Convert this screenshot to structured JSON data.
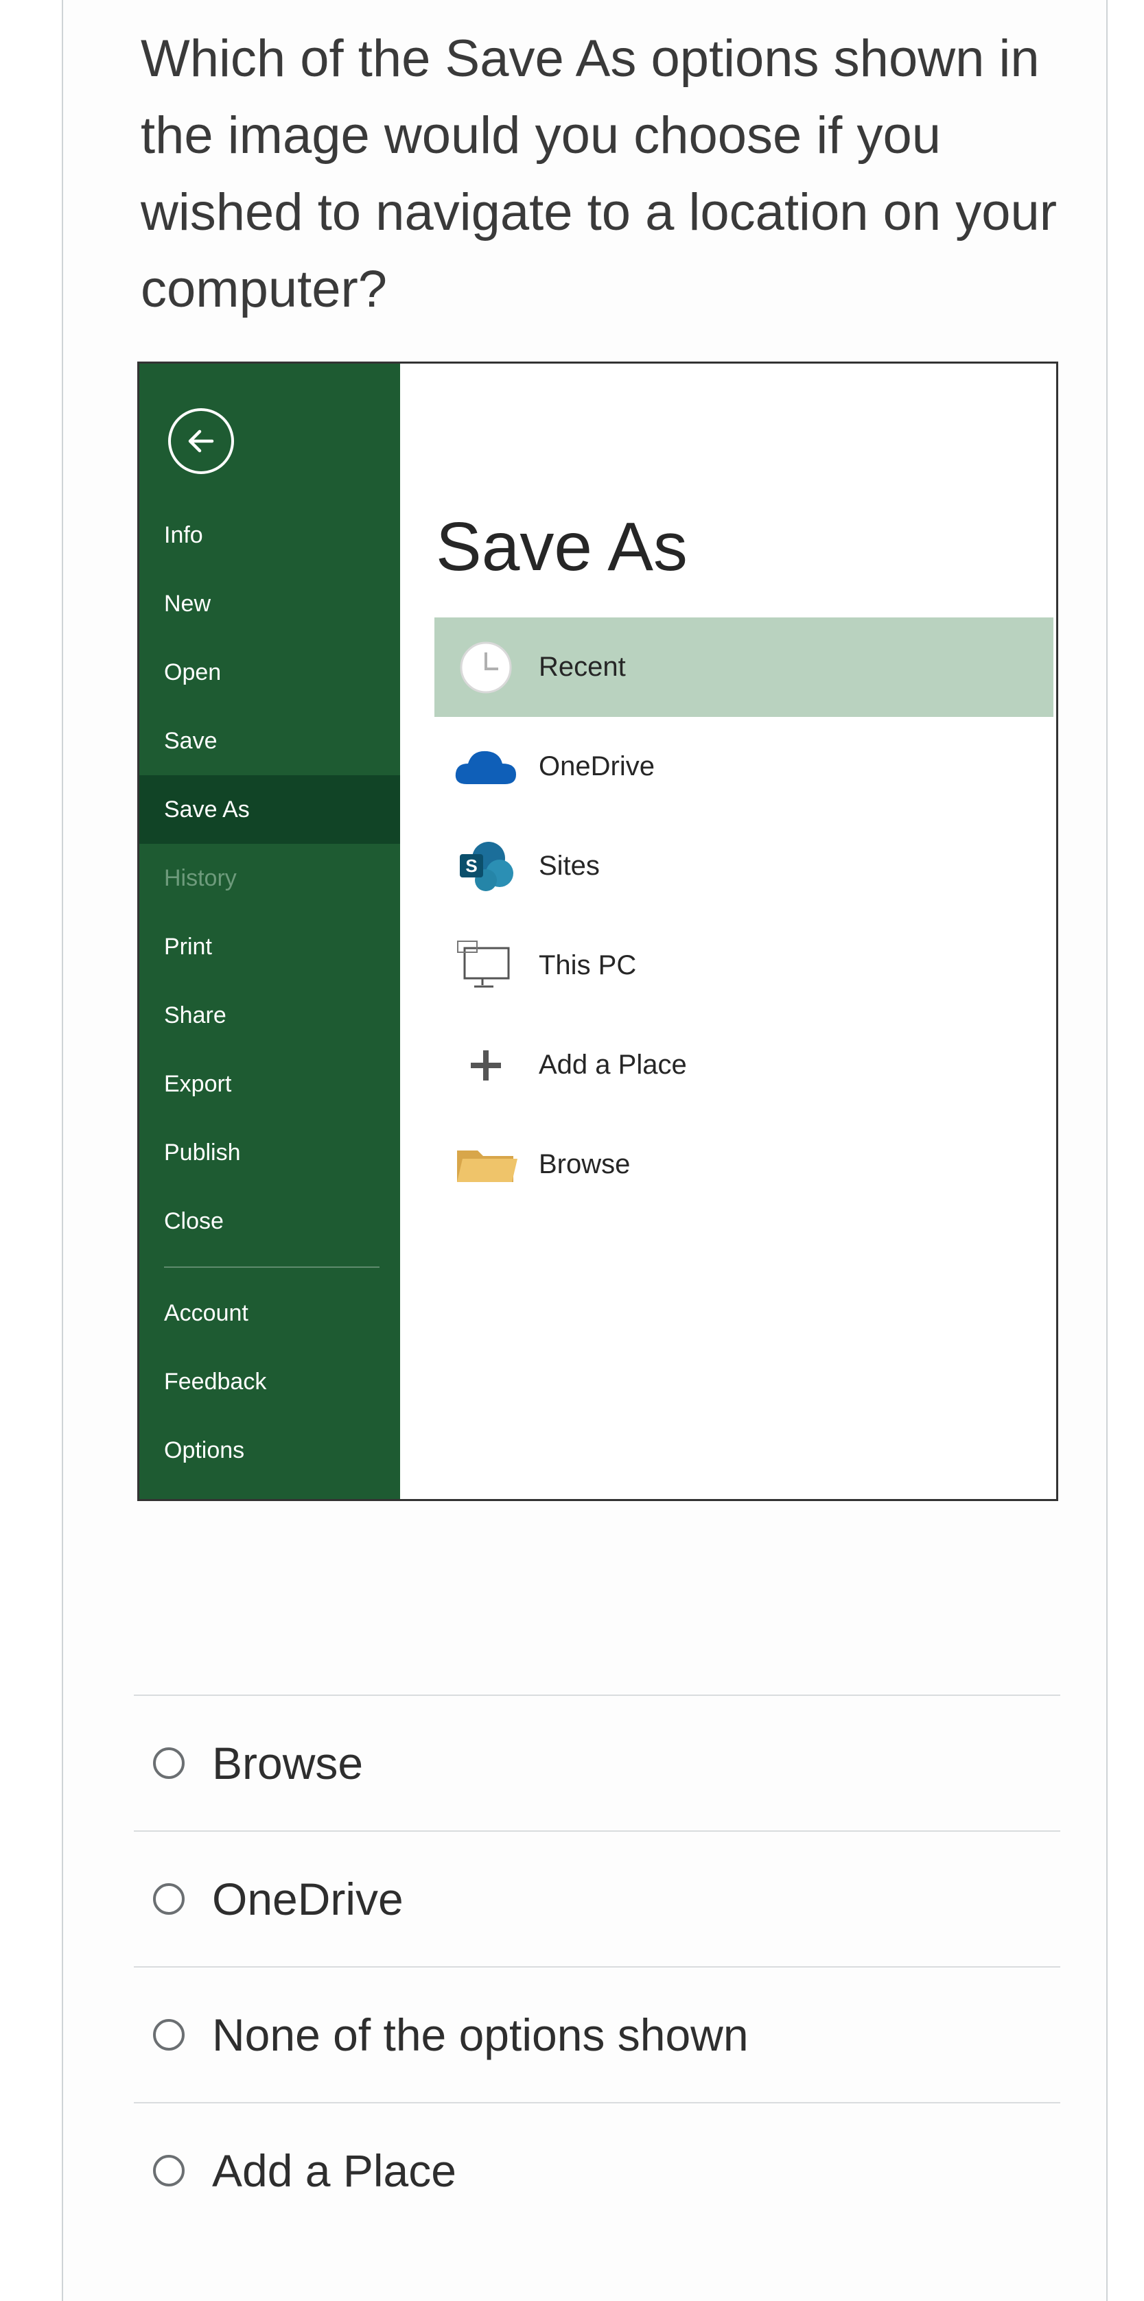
{
  "question": {
    "text": "Which of the Save As options shown in the image would you choose if you wished to navigate to a location on your computer?"
  },
  "backstage": {
    "nav_items": [
      {
        "label": "Info",
        "state": "normal"
      },
      {
        "label": "New",
        "state": "normal"
      },
      {
        "label": "Open",
        "state": "normal"
      },
      {
        "label": "Save",
        "state": "normal"
      },
      {
        "label": "Save As",
        "state": "active"
      },
      {
        "label": "History",
        "state": "disabled"
      },
      {
        "label": "Print",
        "state": "normal"
      },
      {
        "label": "Share",
        "state": "normal"
      },
      {
        "label": "Export",
        "state": "normal"
      },
      {
        "label": "Publish",
        "state": "normal"
      },
      {
        "label": "Close",
        "state": "normal"
      }
    ],
    "nav_bottom_items": [
      {
        "label": "Account"
      },
      {
        "label": "Feedback"
      },
      {
        "label": "Options"
      }
    ],
    "panel_title": "Save As",
    "locations": [
      {
        "label": "Recent",
        "icon": "clock-icon",
        "selected": true
      },
      {
        "label": "OneDrive",
        "icon": "cloud-icon",
        "selected": false
      },
      {
        "label": "Sites",
        "icon": "sharepoint-icon",
        "selected": false
      },
      {
        "label": "This PC",
        "icon": "computer-icon",
        "selected": false
      },
      {
        "label": "Add a Place",
        "icon": "plus-icon",
        "selected": false
      },
      {
        "label": "Browse",
        "icon": "folder-icon",
        "selected": false
      }
    ],
    "colors": {
      "nav_bg": "#1e5b32",
      "nav_active": "#114426",
      "selected_bg": "#b9d2bf",
      "onedrive_blue": "#0f5fb8"
    }
  },
  "answers": [
    {
      "label": "Browse"
    },
    {
      "label": "OneDrive"
    },
    {
      "label": "None of the options shown"
    },
    {
      "label": "Add a Place"
    }
  ]
}
